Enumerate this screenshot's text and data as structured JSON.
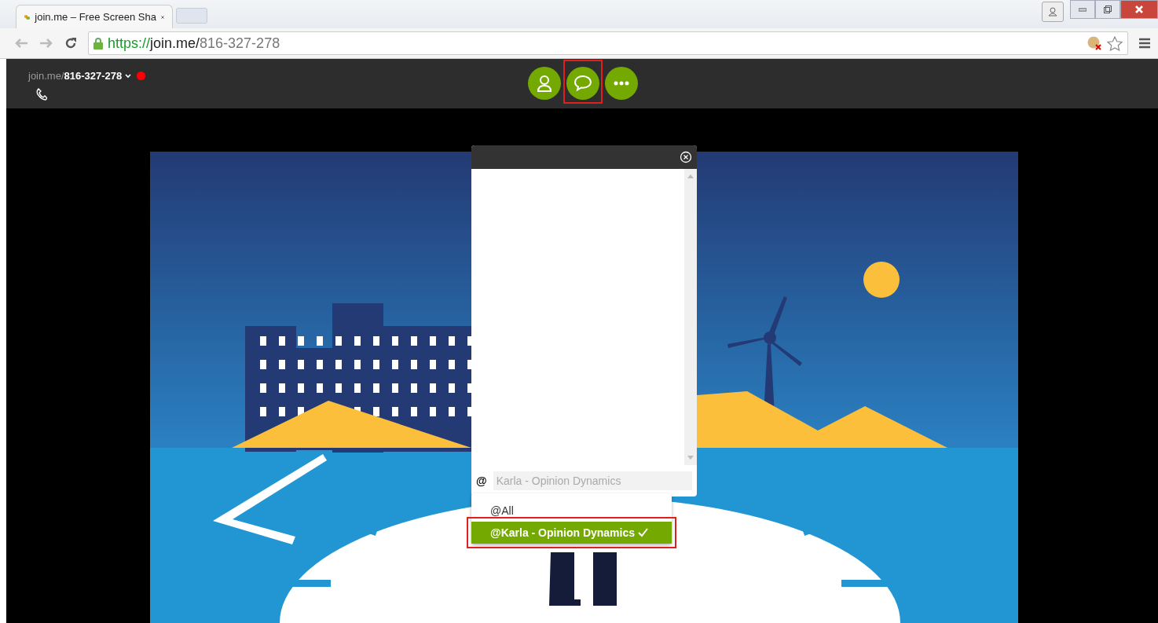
{
  "browser": {
    "tab": {
      "title": "join.me – Free Screen Sha"
    },
    "address": {
      "scheme": "https://",
      "host": "join.me/",
      "path": "816-327-278"
    }
  },
  "meeting": {
    "prefix": "join.me/",
    "code": "816-327-278",
    "recording": true
  },
  "toolbar": [
    {
      "kind": "people",
      "highlighted": false
    },
    {
      "kind": "chat",
      "highlighted": true
    },
    {
      "kind": "more",
      "highlighted": false
    }
  ],
  "chat": {
    "at_symbol": "@",
    "recipient_placeholder": "Karla - Opinion Dynamics",
    "recipients": [
      {
        "label": "@All",
        "selected": false,
        "highlighted": false
      },
      {
        "label": "@Karla - Opinion Dynamics",
        "selected": true,
        "highlighted": true
      }
    ]
  }
}
